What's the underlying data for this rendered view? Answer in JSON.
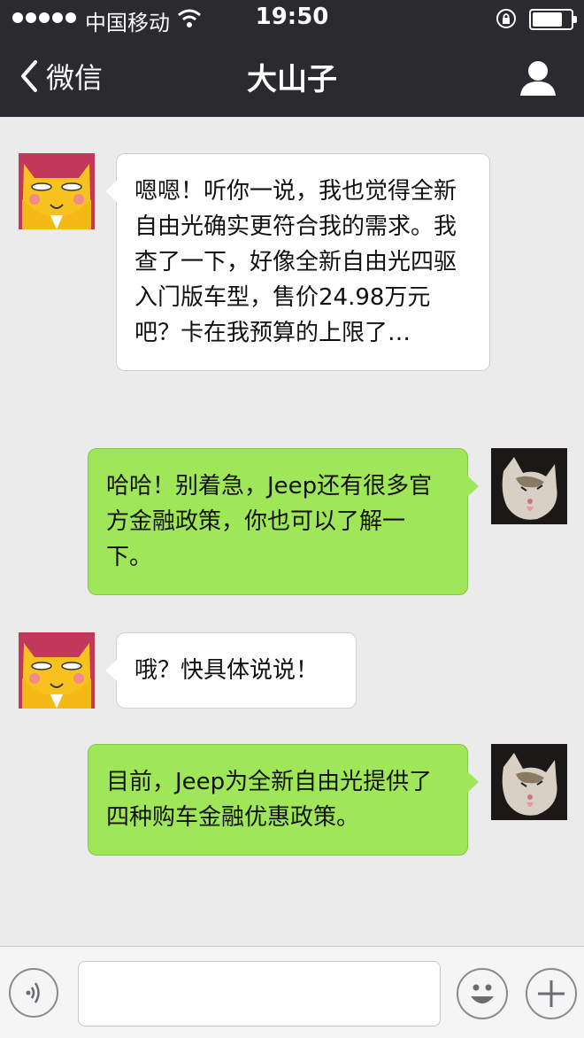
{
  "status_bar": {
    "carrier": "中国移动",
    "time": "19:50",
    "battery_level": 0.72
  },
  "nav": {
    "back_label": "微信",
    "title": "大山子"
  },
  "colors": {
    "nav_bg": "#2b2b2f",
    "chat_bg": "#ebebeb",
    "incoming_bubble": "#ffffff",
    "outgoing_bubble": "#9fe658"
  },
  "messages": [
    {
      "side": "left",
      "avatar": "yellow-cat-avatar",
      "text": "嗯嗯！听你一说，我也觉得全新自由光确实更符合我的需求。我查了一下，好像全新自由光四驱入门版车型，售价24.98万元吧？卡在我预算的上限了…"
    },
    {
      "side": "right",
      "avatar": "cat-photo-avatar",
      "text": "哈哈！别着急，Jeep还有很多官方金融政策，你也可以了解一下。"
    },
    {
      "side": "left",
      "avatar": "yellow-cat-avatar",
      "text": "哦？快具体说说！"
    },
    {
      "side": "right",
      "avatar": "cat-photo-avatar",
      "text": "目前，Jeep为全新自由光提供了四种购车金融优惠政策。"
    }
  ],
  "input_bar": {
    "message_value": "",
    "icons": [
      "voice-icon",
      "emoji-icon",
      "plus-icon"
    ]
  }
}
